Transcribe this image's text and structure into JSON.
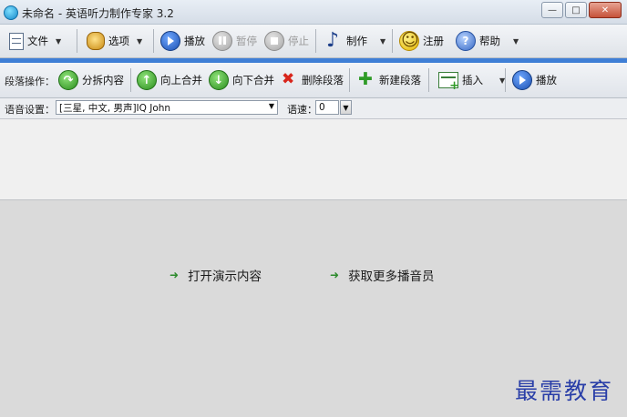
{
  "window": {
    "title": "未命名 - 英语听力制作专家 3.2",
    "minimize": "—",
    "maximize": "□",
    "close": "✕"
  },
  "main_toolbar": {
    "file": "文件",
    "options": "选项",
    "play": "播放",
    "pause": "暂停",
    "stop": "停止",
    "make": "制作",
    "register": "注册",
    "help": "帮助"
  },
  "segment_toolbar": {
    "label": "段落操作：",
    "split": "分拆内容",
    "merge_up": "向上合并",
    "merge_down": "向下合并",
    "delete": "删除段落",
    "new": "新建段落",
    "insert": "插入",
    "play": "播放"
  },
  "voice_settings": {
    "label": "语音设置：",
    "voice_value": "[三星, 中文, 男声]IQ John",
    "speed_label": "语速：",
    "speed_value": "0"
  },
  "links": {
    "open_demo": "打开演示内容",
    "get_more": "获取更多播音员"
  },
  "watermark": "最需教育",
  "icons": [
    "app-icon",
    "document-icon",
    "gear-icon",
    "play-icon",
    "pause-icon",
    "stop-icon",
    "music-note-icon",
    "smiley-icon",
    "help-icon",
    "split-icon",
    "arrow-up-icon",
    "arrow-down-icon",
    "delete-icon",
    "plus-icon",
    "insert-icon"
  ]
}
